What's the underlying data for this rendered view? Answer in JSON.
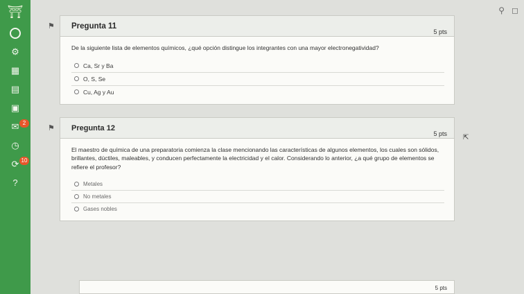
{
  "sidebar": {
    "items": [
      {
        "name": "logo",
        "icon": "institution-logo-icon"
      },
      {
        "name": "account",
        "icon": "account-icon"
      },
      {
        "name": "admin",
        "icon": "admin-icon"
      },
      {
        "name": "dashboard",
        "icon": "dashboard-icon"
      },
      {
        "name": "courses",
        "icon": "courses-icon"
      },
      {
        "name": "calendar",
        "icon": "calendar-icon"
      },
      {
        "name": "inbox",
        "icon": "inbox-icon",
        "badge": "2"
      },
      {
        "name": "history",
        "icon": "history-icon"
      },
      {
        "name": "commons",
        "icon": "commons-icon",
        "badge": "10"
      },
      {
        "name": "help",
        "icon": "help-icon"
      }
    ]
  },
  "questions": [
    {
      "title": "Pregunta 11",
      "points": "5 pts",
      "text": "De la siguiente lista de elementos químicos, ¿qué opción distingue los integrantes con una mayor electronegatividad?",
      "answers": [
        "Ca, Sr y Ba",
        "O, S, Se",
        "Cu, Ag y Au"
      ]
    },
    {
      "title": "Pregunta 12",
      "points": "5 pts",
      "text": "El maestro de química de una preparatoria comienza la clase mencionando las características de algunos elementos, los cuales son sólidos, brillantes, dúctiles, maleables, y conducen perfectamente la electricidad y el calor. Considerando lo anterior, ¿a qué grupo de elementos se refiere el profesor?",
      "answers": [
        "Metales",
        "No metales",
        "Gases nobles"
      ]
    }
  ],
  "next_question": {
    "points": "5 pts"
  },
  "colors": {
    "sidebar": "#3f9a4a",
    "badge": "#e8562a"
  }
}
